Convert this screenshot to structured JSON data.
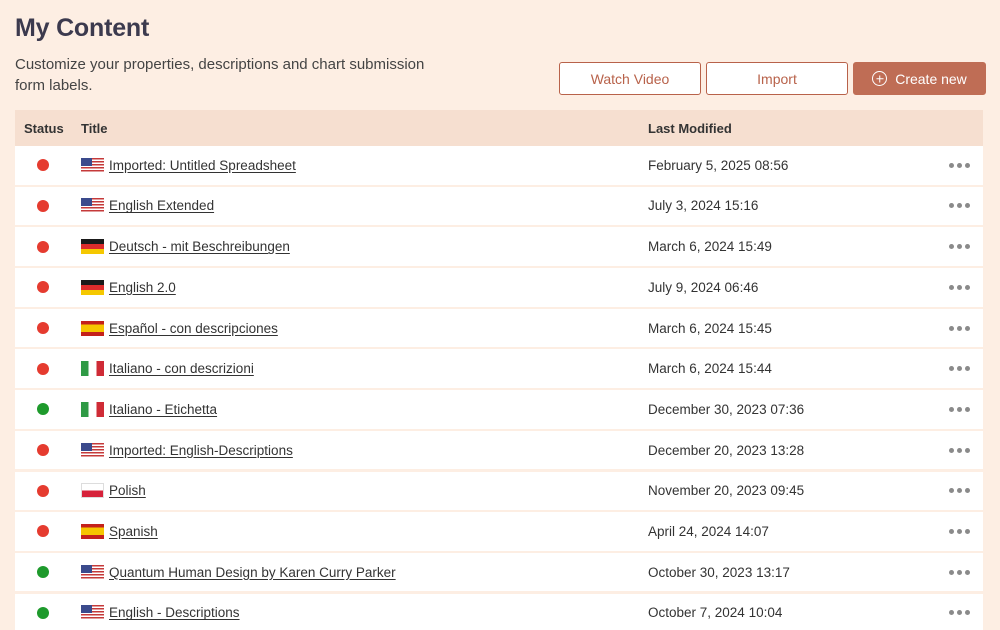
{
  "header": {
    "title": "My Content",
    "subtitle": "Customize your properties, descriptions and chart submission form labels."
  },
  "actions": {
    "watch_video": "Watch Video",
    "import": "Import",
    "create_new": "Create new"
  },
  "table": {
    "columns": {
      "status": "Status",
      "title": "Title",
      "last_modified": "Last Modified"
    },
    "rows": [
      {
        "status": "red",
        "flag": "us",
        "title": "Imported: Untitled Spreadsheet",
        "modified": "February 5, 2025 08:56"
      },
      {
        "status": "red",
        "flag": "us",
        "title": "English Extended",
        "modified": "July 3, 2024 15:16"
      },
      {
        "status": "red",
        "flag": "de",
        "title": "Deutsch - mit Beschreibungen",
        "modified": "March 6, 2024 15:49"
      },
      {
        "status": "red",
        "flag": "de",
        "title": "English 2.0",
        "modified": "July 9, 2024 06:46"
      },
      {
        "status": "red",
        "flag": "es",
        "title": "Español - con descripciones",
        "modified": "March 6, 2024 15:45"
      },
      {
        "status": "red",
        "flag": "it",
        "title": "Italiano - con descrizioni",
        "modified": "March 6, 2024 15:44"
      },
      {
        "status": "green",
        "flag": "it",
        "title": "Italiano - Etichetta",
        "modified": "December 30, 2023 07:36"
      },
      {
        "status": "red",
        "flag": "us",
        "title": "Imported: English-Descriptions",
        "modified": "December 20, 2023 13:28"
      },
      {
        "status": "red",
        "flag": "pl",
        "title": "Polish",
        "modified": "November 20, 2023 09:45"
      },
      {
        "status": "red",
        "flag": "es",
        "title": "Spanish",
        "modified": "April 24, 2024 14:07"
      },
      {
        "status": "green",
        "flag": "us",
        "title": "Quantum Human Design by Karen Curry Parker",
        "modified": "October 30, 2023 13:17"
      },
      {
        "status": "green",
        "flag": "us",
        "title": "English - Descriptions",
        "modified": "October 7, 2024 10:04"
      }
    ]
  },
  "colors": {
    "background": "#fdeee3",
    "accent": "#bf6d55",
    "status_red": "#e53b2f",
    "status_green": "#1e9a2c"
  },
  "icons": {
    "create": "plus-circle-icon",
    "row_menu": "more-horizontal-icon"
  }
}
